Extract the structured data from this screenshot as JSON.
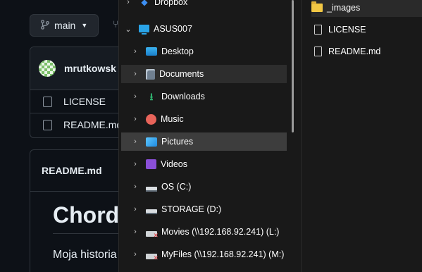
{
  "github": {
    "branch": "main",
    "commit_author": "mrutkowsk",
    "files": [
      "LICENSE",
      "README.md"
    ],
    "readme_title": "README.md",
    "readme_heading": "Chord",
    "readme_text": "Moja historia"
  },
  "nav": {
    "items": [
      {
        "label": "Dropbox",
        "icon": "dropbox-icon"
      },
      {
        "label": "ASUS007",
        "icon": "this-pc-icon"
      },
      {
        "label": "Desktop",
        "icon": "desktop-folder-icon"
      },
      {
        "label": "Documents",
        "icon": "documents-folder-icon"
      },
      {
        "label": "Downloads",
        "icon": "downloads-folder-icon"
      },
      {
        "label": "Music",
        "icon": "music-folder-icon"
      },
      {
        "label": "Pictures",
        "icon": "pictures-folder-icon"
      },
      {
        "label": "Videos",
        "icon": "videos-folder-icon"
      },
      {
        "label": "OS (C:)",
        "icon": "system-drive-icon"
      },
      {
        "label": "STORAGE (D:)",
        "icon": "drive-icon"
      },
      {
        "label": "Movies (\\\\192.168.92.241) (L:)",
        "icon": "network-drive-disconnected-icon"
      },
      {
        "label": "MyFiles (\\\\192.168.92.241) (M:)",
        "icon": "network-drive-disconnected-icon"
      }
    ]
  },
  "content": {
    "items": [
      {
        "name": "_images",
        "type": "folder"
      },
      {
        "name": "LICENSE",
        "type": "file"
      },
      {
        "name": "README.md",
        "type": "file"
      }
    ]
  }
}
